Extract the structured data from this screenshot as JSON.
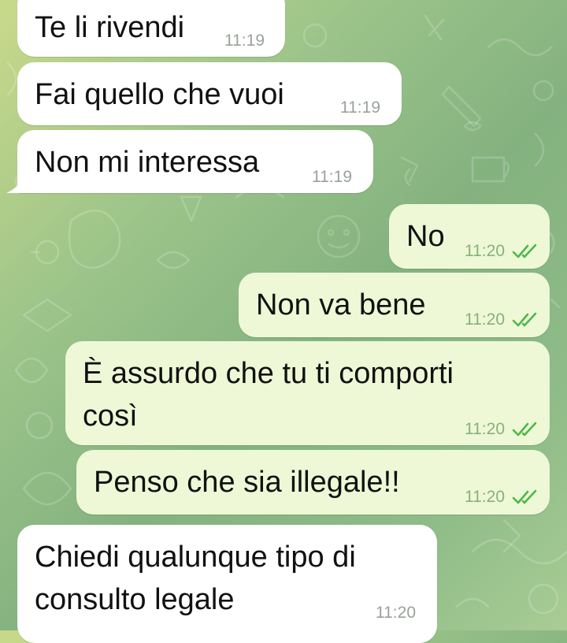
{
  "chat": {
    "messages": [
      {
        "dir": "in",
        "text_lines": [
          "Te li rivendi"
        ],
        "time": "11:19"
      },
      {
        "dir": "in",
        "text_lines": [
          "Fai quello che vuoi"
        ],
        "time": "11:19"
      },
      {
        "dir": "in",
        "text_lines": [
          "Non mi interessa"
        ],
        "time": "11:19"
      },
      {
        "dir": "out",
        "text_lines": [
          "No"
        ],
        "time": "11:20",
        "status": "read"
      },
      {
        "dir": "out",
        "text_lines": [
          "Non va bene"
        ],
        "time": "11:20",
        "status": "read"
      },
      {
        "dir": "out",
        "text_lines": [
          "È assurdo che tu ti comporti",
          "così"
        ],
        "time": "11:20",
        "status": "read"
      },
      {
        "dir": "out",
        "text_lines": [
          "Penso che sia illegale!!"
        ],
        "time": "11:20",
        "status": "read"
      },
      {
        "dir": "in",
        "text_lines": [
          "Chiedi qualunque tipo di",
          "consulto legale"
        ],
        "time": "11:20"
      }
    ]
  },
  "icons": {
    "read_receipt": "double-check-icon"
  },
  "colors": {
    "incoming_bubble": "#ffffff",
    "outgoing_bubble": "#eef8d6",
    "read_ticks": "#4db84a",
    "time_incoming": "#9aa19a",
    "time_outgoing": "#88b07a"
  }
}
